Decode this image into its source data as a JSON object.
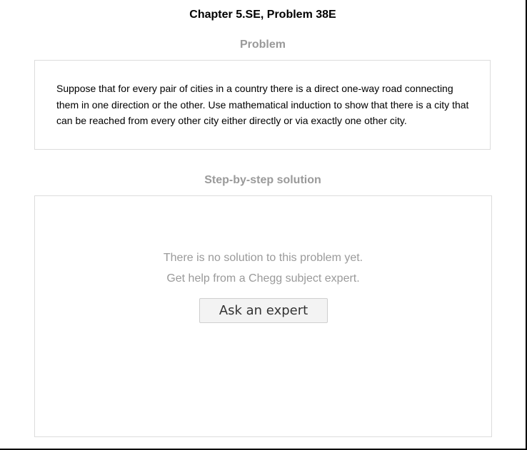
{
  "header": {
    "chapter_title": "Chapter 5.SE, Problem 38E"
  },
  "problem": {
    "heading": "Problem",
    "text": "Suppose that for every pair of cities in a country there is a direct one-way road connecting them in one direction or the other. Use mathematical induction to show that there is a city that can be reached from every other city either directly or via exactly one other city."
  },
  "solution": {
    "heading": "Step-by-step solution",
    "no_solution_line1": "There is no solution to this problem yet.",
    "no_solution_line2": "Get help from a Chegg subject expert.",
    "ask_button_label": "Ask an expert"
  }
}
